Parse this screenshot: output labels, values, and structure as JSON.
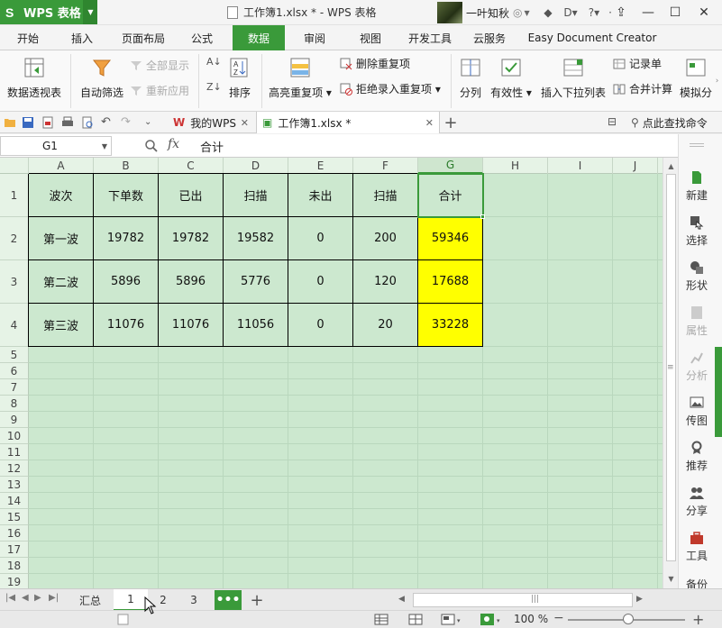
{
  "window": {
    "app_name": "WPS 表格",
    "doc_title": "工作簿1.xlsx * - WPS 表格",
    "user_name": "一叶知秋"
  },
  "menu": {
    "tabs": [
      "开始",
      "插入",
      "页面布局",
      "公式",
      "数据",
      "审阅",
      "视图",
      "开发工具",
      "云服务",
      "Easy Document Creator"
    ],
    "active": "数据"
  },
  "ribbon": {
    "pivot": "数据透视表",
    "autofilter": "自动筛选",
    "show_all": "全部显示",
    "reapply": "重新应用",
    "sort": "排序",
    "highlight_dup": "高亮重复项",
    "remove_dup": "删除重复项",
    "reject_dup": "拒绝录入重复项",
    "split": "分列",
    "validity": "有效性",
    "insert_dropdown": "插入下拉列表",
    "record": "记录单",
    "merge_calc": "合并计算",
    "simulate": "模拟分"
  },
  "doc_tabs": {
    "my_wps": "我的WPS",
    "workbook": "工作簿1.xlsx *",
    "search": "点此查找命令"
  },
  "formula_bar": {
    "name_box": "G1",
    "fx": "fx",
    "formula": "合计"
  },
  "sheet": {
    "columns": [
      "A",
      "B",
      "C",
      "D",
      "E",
      "F",
      "G",
      "H",
      "I",
      "J"
    ],
    "rows": [
      "1",
      "2",
      "3",
      "4",
      "5",
      "6",
      "7",
      "8",
      "9",
      "10",
      "11",
      "12",
      "13",
      "14",
      "15",
      "16",
      "17",
      "18",
      "19"
    ],
    "header": [
      "波次",
      "下单数",
      "已出",
      "扫描",
      "未出",
      "扫描",
      "合计"
    ],
    "data": [
      [
        "第一波",
        "19782",
        "19782",
        "19582",
        "0",
        "200",
        "59346"
      ],
      [
        "第二波",
        "5896",
        "5896",
        "5776",
        "0",
        "120",
        "17688"
      ],
      [
        "第三波",
        "11076",
        "11076",
        "11056",
        "0",
        "20",
        "33228"
      ]
    ],
    "selected_cell": "G1",
    "highlight_color": "#ffff00"
  },
  "right_panel": {
    "items": [
      "新建",
      "选择",
      "形状",
      "属性",
      "分析",
      "传图",
      "推荐",
      "分享",
      "工具",
      "备份"
    ]
  },
  "sheet_tabs": {
    "tabs": [
      "汇总",
      "1",
      "2",
      "3"
    ],
    "active": "1"
  },
  "status": {
    "zoom": "100 %"
  },
  "colors": {
    "accent": "#3a9a3a",
    "grid_bg": "#cce8cf"
  }
}
